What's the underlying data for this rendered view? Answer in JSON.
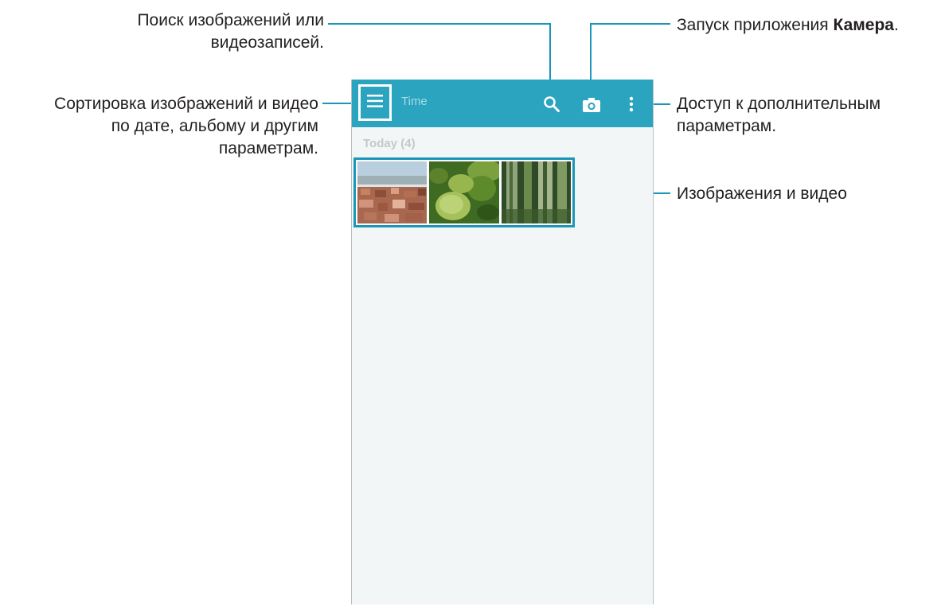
{
  "callouts": {
    "search": [
      "Поиск изображений или",
      "видеозаписей."
    ],
    "sort": [
      "Сортировка изображений и видео",
      "по дате, альбому и другим",
      "параметрам."
    ],
    "camera_prefix": "Запуск приложения ",
    "camera_bold": "Камера",
    "camera_suffix": ".",
    "more": [
      "Доступ к дополнительным",
      "параметрам."
    ],
    "media": "Изображения и видео"
  },
  "appbar": {
    "title": "Time",
    "icons": [
      "menu-icon",
      "search-icon",
      "camera-icon",
      "more-vert-icon"
    ]
  },
  "gallery": {
    "section_title": "Today (4)",
    "thumbnails": [
      {
        "name": "thumbnail-town-rooftops",
        "alt": "town rooftops"
      },
      {
        "name": "thumbnail-green-flower",
        "alt": "green flower"
      },
      {
        "name": "thumbnail-mossy-tree",
        "alt": "mossy tree trunks"
      }
    ]
  },
  "colors": {
    "accent": "#1a97b8",
    "appbar": "#2ba4bf",
    "background": "#f3f6f6"
  }
}
